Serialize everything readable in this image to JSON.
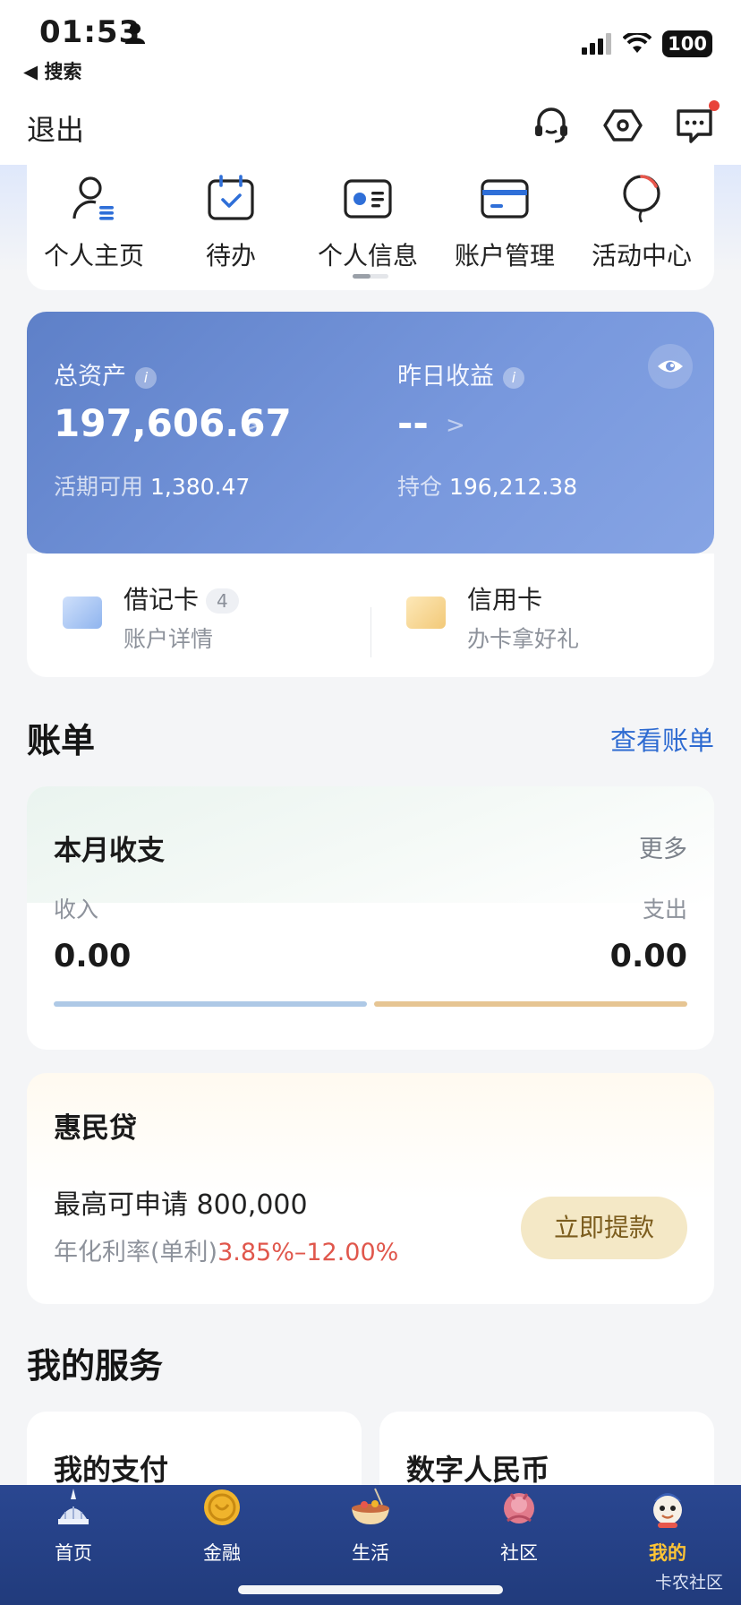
{
  "status_bar": {
    "time": "01:53",
    "back_label": "◀ 搜索",
    "battery": "100"
  },
  "top_bar": {
    "exit_label": "退出"
  },
  "quick_menu": [
    {
      "label": "个人主页",
      "icon": "user-list-icon"
    },
    {
      "label": "待办",
      "icon": "calendar-check-icon"
    },
    {
      "label": "个人信息",
      "icon": "id-card-icon"
    },
    {
      "label": "账户管理",
      "icon": "bank-card-icon"
    },
    {
      "label": "活动中心",
      "icon": "balloon-icon"
    }
  ],
  "assets": {
    "total_label": "总资产",
    "total_value": "197,606.67",
    "available_label": "活期可用",
    "available_value": "1,380.47",
    "yesterday_label": "昨日收益",
    "yesterday_value": "--",
    "holding_label": "持仓",
    "holding_value": "196,212.38",
    "info_glyph": "i"
  },
  "cards": {
    "debit": {
      "title": "借记卡",
      "count": "4",
      "sub": "账户详情"
    },
    "credit": {
      "title": "信用卡",
      "sub": "办卡拿好礼"
    }
  },
  "bill": {
    "section_title": "账单",
    "view_link": "查看账单",
    "card_title": "本月收支",
    "more": "更多",
    "income_label": "收入",
    "income_value": "0.00",
    "expense_label": "支出",
    "expense_value": "0.00",
    "income_color": "#aec9e6",
    "expense_color": "#e6c593"
  },
  "loan": {
    "title": "惠民贷",
    "max_label": "最高可申请 800,000",
    "rate_label": "年化利率(单利)",
    "rate_value": "3.85%–12.00%",
    "button": "立即提款"
  },
  "services": {
    "section_title": "我的服务",
    "items": [
      {
        "title": "我的支付"
      },
      {
        "title": "数字人民币"
      }
    ]
  },
  "tab_bar": {
    "tabs": [
      {
        "label": "首页",
        "icon": "landmark-icon",
        "active": false
      },
      {
        "label": "金融",
        "icon": "gold-coin-icon",
        "active": false
      },
      {
        "label": "生活",
        "icon": "food-bowl-icon",
        "active": false
      },
      {
        "label": "社区",
        "icon": "community-icon",
        "active": false
      },
      {
        "label": "我的",
        "icon": "mascot-icon",
        "active": true
      }
    ],
    "community_tag": "卡农社区"
  },
  "colors": {
    "accent_blue": "#2e6bd1",
    "tab_bg": "#253f83",
    "active_tab": "#ffc535",
    "rate_red": "#e0574c"
  }
}
